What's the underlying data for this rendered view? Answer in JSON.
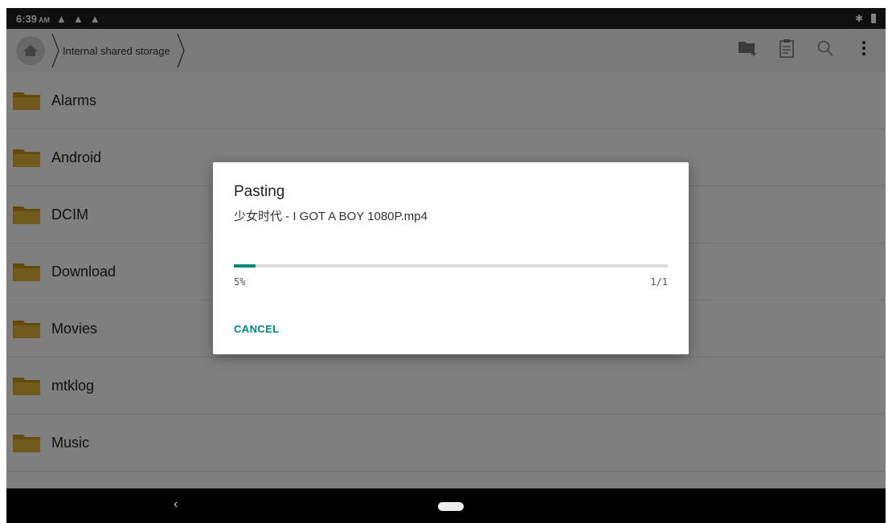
{
  "status_bar": {
    "time": "6:39",
    "ampm": "AM",
    "warning_icons": [
      "warning-icon",
      "warning-icon",
      "warning-icon"
    ],
    "right_icons": [
      "bluetooth-icon",
      "battery-icon"
    ]
  },
  "toolbar": {
    "breadcrumb": "Internal shared storage",
    "icons": [
      "new-folder-icon",
      "clipboard-icon",
      "search-icon",
      "more-vert-icon"
    ]
  },
  "folders": [
    {
      "label": "Alarms"
    },
    {
      "label": "Android"
    },
    {
      "label": "DCIM"
    },
    {
      "label": "Download"
    },
    {
      "label": "Movies"
    },
    {
      "label": "mtklog"
    },
    {
      "label": "Music"
    }
  ],
  "dialog": {
    "title": "Pasting",
    "file_name": "少女时代 - I GOT A BOY 1080P.mp4",
    "progress": 0.05,
    "percent_text": "5%",
    "count_text": "1/1",
    "cancel_label": "CANCEL"
  },
  "colors": {
    "accent": "#00897b",
    "folder": "#c9961a"
  }
}
